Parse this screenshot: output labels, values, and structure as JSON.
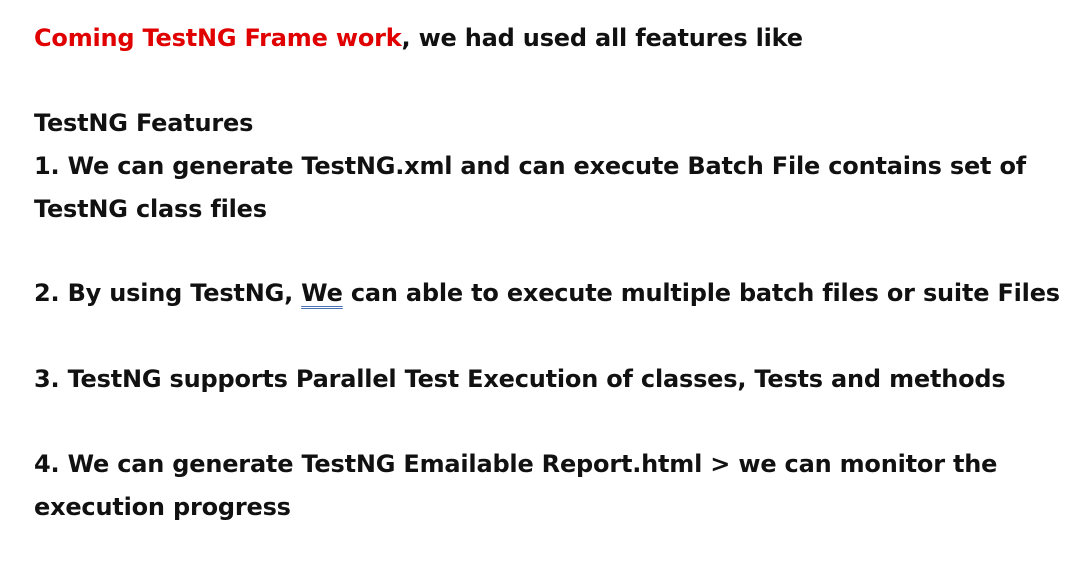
{
  "intro": {
    "highlight": "Coming TestNG Frame work",
    "rest": ", we had used all features like"
  },
  "heading": "TestNG Features",
  "features": [
    {
      "line1": "1. We can generate TestNG.xml and can execute Batch File contains set of",
      "line2": "TestNG class files"
    },
    {
      "pre": "2. By using TestNG, ",
      "flagged": "We",
      "post": " can able to execute multiple batch files or suite Files"
    },
    {
      "line1": "3. TestNG supports Parallel Test Execution of classes, Tests and methods"
    },
    {
      "line1": "4. We can generate TestNG Emailable Report.html > we can monitor the",
      "line2": "execution progress"
    }
  ],
  "colors": {
    "highlight": "#e00000",
    "text": "#111111",
    "grammar_underline": "#4a6fb5"
  }
}
